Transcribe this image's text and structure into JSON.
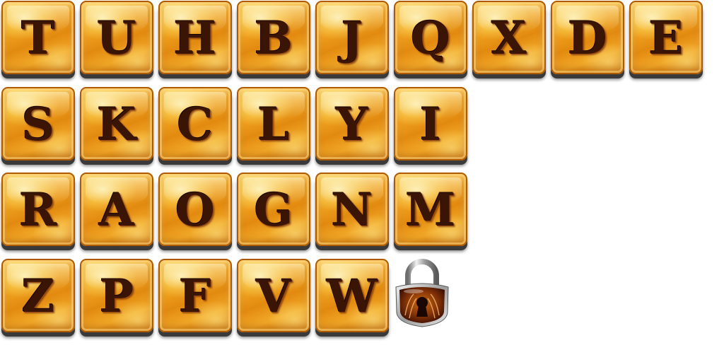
{
  "board": {
    "rows": [
      [
        "T",
        "U",
        "H",
        "B",
        "J",
        "Q",
        "X",
        "D",
        "E"
      ],
      [
        "S",
        "K",
        "C",
        "L",
        "Y",
        "I"
      ],
      [
        "R",
        "A",
        "O",
        "G",
        "N",
        "M"
      ],
      [
        "Z",
        "P",
        "F",
        "V",
        "W"
      ]
    ]
  },
  "lock": {
    "icon": "padlock-icon"
  },
  "colors": {
    "tile_gold": "#f0a21e",
    "tile_border": "#b05a00",
    "letter": "#3a1505",
    "tile_shadow": "#3a3a3a"
  }
}
